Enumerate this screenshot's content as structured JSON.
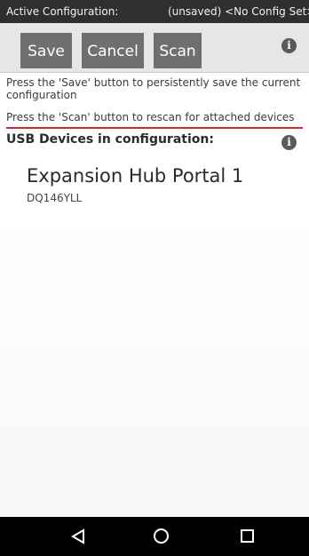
{
  "status_bar": {
    "left_label": "Active Configuration:",
    "right_label": "(unsaved) <No Config Set>"
  },
  "toolbar": {
    "save_label": "Save",
    "cancel_label": "Cancel",
    "scan_label": "Scan",
    "info_icon_glyph": "i"
  },
  "help": {
    "save_text": "Press the 'Save' button to persistently save the current configuration",
    "scan_text": "Press the 'Scan' button to rescan for attached devices"
  },
  "usb_section": {
    "title": "USB Devices in configuration:",
    "info_icon_glyph": "i",
    "devices": [
      {
        "name": "Expansion Hub Portal 1",
        "serial": "DQ146YLL"
      }
    ]
  },
  "nav_bar": {
    "back_icon": "back-icon",
    "home_icon": "home-icon",
    "recents_icon": "recents-icon"
  },
  "colors": {
    "status_bar": "#2f2f2f",
    "toolbar": "#e6e6e6",
    "button": "#6f6f6f",
    "accent_line": "#d8242c",
    "nav_bar": "#000000"
  }
}
